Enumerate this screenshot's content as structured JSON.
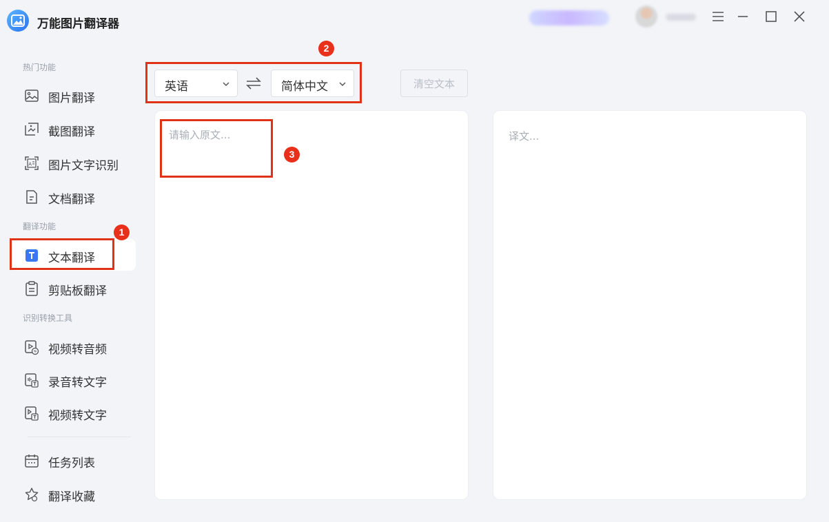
{
  "app": {
    "title": "万能图片翻译器"
  },
  "colors": {
    "accent": "#2b73f0",
    "callout": "#e03216",
    "background": "#f2f4f8"
  },
  "sidebar": {
    "sections": [
      {
        "label": "热门功能"
      },
      {
        "label": "翻译功能"
      },
      {
        "label": "识别转换工具"
      }
    ],
    "items": [
      {
        "label": "图片翻译",
        "icon": "image-icon"
      },
      {
        "label": "截图翻译",
        "icon": "screenshot-icon"
      },
      {
        "label": "图片文字识别",
        "icon": "ocr-icon"
      },
      {
        "label": "文档翻译",
        "icon": "document-icon"
      },
      {
        "label": "文本翻译",
        "icon": "text-icon",
        "active": true
      },
      {
        "label": "剪贴板翻译",
        "icon": "clipboard-icon"
      },
      {
        "label": "视频转音频",
        "icon": "video-audio-icon"
      },
      {
        "label": "录音转文字",
        "icon": "audio-text-icon"
      },
      {
        "label": "视频转文字",
        "icon": "video-text-icon"
      },
      {
        "label": "任务列表",
        "icon": "calendar-icon"
      },
      {
        "label": "翻译收藏",
        "icon": "star-icon"
      }
    ]
  },
  "toolbar": {
    "source_language": "英语",
    "target_language": "简体中文",
    "clear_label": "清空文本"
  },
  "source_panel": {
    "placeholder": "请输入原文..."
  },
  "target_panel": {
    "placeholder": "译文..."
  },
  "callouts": [
    "1",
    "2",
    "3"
  ]
}
